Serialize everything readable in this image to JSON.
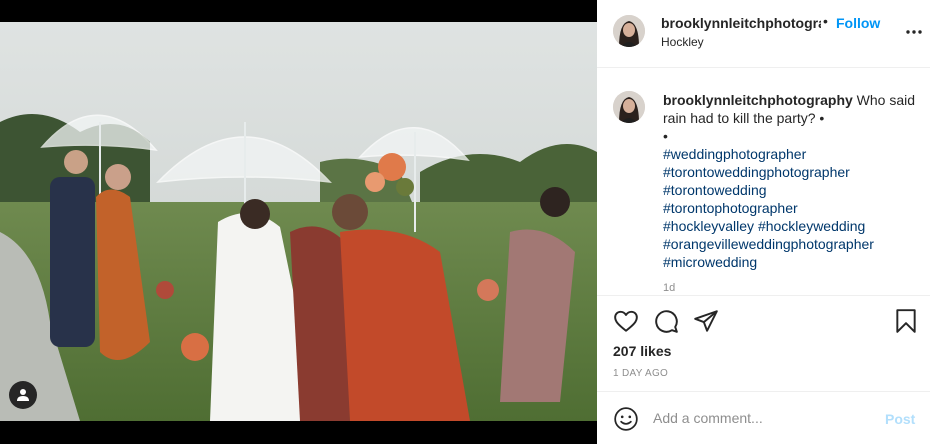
{
  "post": {
    "username": "brooklynnleitchphotography",
    "header_dot": "•",
    "follow_label": "Follow",
    "location": "Hockley",
    "caption_text": " Who said rain had to kill the party? •",
    "caption_dot": "•",
    "hashtags": [
      "#weddingphotographer",
      "#torontoweddingphotographer",
      "#torontowedding",
      "#torontophotographer",
      "#hockleyvalley #hockleywedding",
      "#orangevilleweddingphotographer",
      "#microwedding"
    ],
    "caption_time": "1d",
    "likes": "207 likes",
    "posted_ago": "1 DAY AGO"
  },
  "comment": {
    "placeholder": "Add a comment...",
    "post_label": "Post"
  },
  "icons": {
    "tag": "user-tag-icon",
    "more": "more-options-icon",
    "like": "heart-icon",
    "comment": "comment-bubble-icon",
    "share": "paper-plane-icon",
    "save": "bookmark-icon",
    "emoji": "emoji-icon"
  },
  "colors": {
    "follow": "#0095f6",
    "hashtag": "#00376b",
    "post_disabled": "#b2dffc",
    "muted": "#8e8e8e"
  }
}
